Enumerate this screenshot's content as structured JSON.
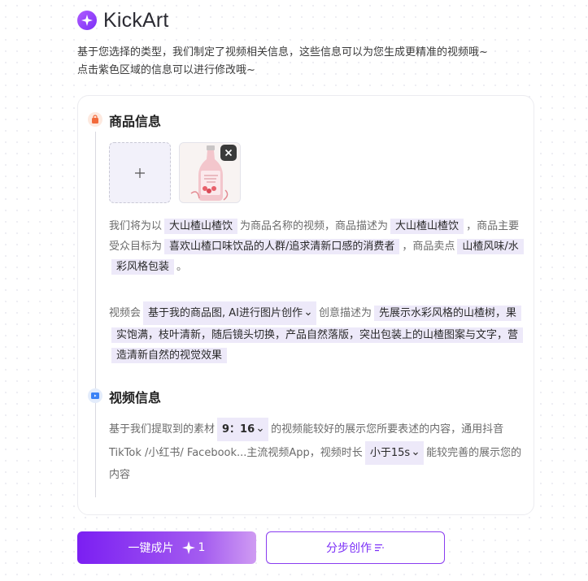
{
  "app": {
    "name": "KickArt"
  },
  "intro": {
    "line1": "基于您选择的类型，我们制定了视频相关信息，这些信息可以为您生成更精准的视频哦~",
    "line2": "点击紫色区域的信息可以进行修改哦~"
  },
  "product_section": {
    "title": "商品信息",
    "upload_icon": "plus-icon",
    "product_image": "product-bottle-thumbnail",
    "sentence": {
      "t1": "我们将为以",
      "name": "大山楂山楂饮",
      "t2": "为商品名称的视频，商品描述为",
      "description": "大山楂山楂饮",
      "t3": "，商品主要受众目标为",
      "audience": "喜欢山楂口味饮品的人群/追求清新口感的消费者",
      "t4": "，商品卖点",
      "selling_point": "山楂风味/水彩风格包装",
      "t5": "。"
    },
    "creative": {
      "t1": "视频会",
      "mode": "基于我的商品图, AI进行图片创作",
      "t2": "创意描述为",
      "description": "先展示水彩风格的山楂树，果实饱满，枝叶清新，随后镜头切换，产品自然落版，突出包装上的山楂图案与文字，营造清新自然的视觉效果"
    }
  },
  "video_section": {
    "title": "视频信息",
    "sentence": {
      "t1": "基于我们提取到的素材",
      "ratio": "9：16",
      "t2": "的视频能较好的展示您所要表述的内容，通用抖音TikTok /小红书/ Facebook...主流视频App，视频时长",
      "duration": "小于15s",
      "t3": "能较完善的展示您的内容"
    }
  },
  "buttons": {
    "one_click": "一键成片",
    "credit_cost": "1",
    "step_by_step": "分步创作"
  },
  "colors": {
    "accent": "#7b2ff7",
    "highlight_bg": "#ede9f9",
    "goods_icon": "#f26a3b",
    "video_icon": "#3b82f6"
  }
}
